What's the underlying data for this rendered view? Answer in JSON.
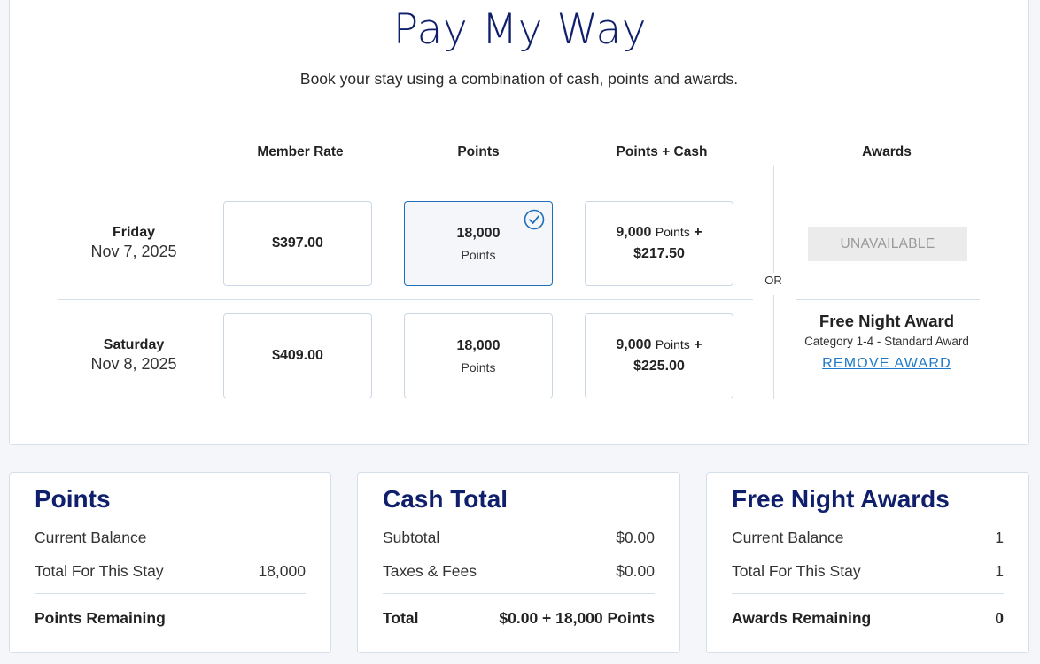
{
  "header": {
    "title": "Pay My Way",
    "subtitle": "Book your stay using a combination of cash, points and awards."
  },
  "columns": [
    "Member Rate",
    "Points",
    "Points + Cash",
    "Awards"
  ],
  "or_label": "OR",
  "nights": [
    {
      "day": "Friday",
      "date": "Nov 7, 2025",
      "member_rate": "$397.00",
      "points": {
        "value": "18,000",
        "unit": "Points",
        "selected": true
      },
      "points_cash": {
        "points": "9,000",
        "unit": "Points",
        "plus": "+",
        "cash": "$217.50"
      },
      "award": {
        "status": "UNAVAILABLE"
      }
    },
    {
      "day": "Saturday",
      "date": "Nov 8, 2025",
      "member_rate": "$409.00",
      "points": {
        "value": "18,000",
        "unit": "Points",
        "selected": false
      },
      "points_cash": {
        "points": "9,000",
        "unit": "Points",
        "plus": "+",
        "cash": "$225.00"
      },
      "award": {
        "name": "Free Night Award",
        "category": "Category 1-4 - Standard Award",
        "remove_label": "REMOVE AWARD"
      }
    }
  ],
  "summary": {
    "points": {
      "title": "Points",
      "rows": [
        {
          "label": "Current Balance",
          "value": ""
        },
        {
          "label": "Total For This Stay",
          "value": "18,000"
        }
      ],
      "total": {
        "label": "Points Remaining",
        "value": ""
      }
    },
    "cash": {
      "title": "Cash Total",
      "rows": [
        {
          "label": "Subtotal",
          "value": "$0.00"
        },
        {
          "label": "Taxes & Fees",
          "value": "$0.00"
        }
      ],
      "total": {
        "label": "Total",
        "value": "$0.00 + 18,000 Points"
      }
    },
    "awards": {
      "title": "Free Night Awards",
      "rows": [
        {
          "label": "Current Balance",
          "value": "1"
        },
        {
          "label": "Total For This Stay",
          "value": "1"
        }
      ],
      "total": {
        "label": "Awards Remaining",
        "value": "0"
      }
    }
  },
  "colors": {
    "brand_navy": "#0f1f6b",
    "link_blue": "#1f7ac9",
    "selected_border": "#1f6fb8"
  }
}
